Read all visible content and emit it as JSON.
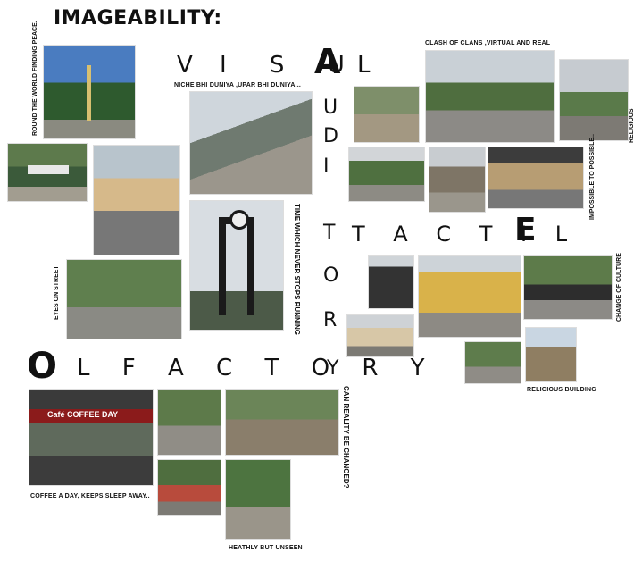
{
  "title": "IMAGEABILITY:",
  "senses": {
    "visual_v": "V",
    "visual_rest1": "I S U",
    "visual_a": "A",
    "visual_l": "L",
    "auditory_letters": [
      "U",
      "D",
      "I",
      "T",
      "O",
      "R",
      "Y"
    ],
    "tactile": "T A C T I L",
    "tactile_e": "E",
    "olfactory_o": "O",
    "olfactory_rest": "L F A C T O R Y"
  },
  "captions": {
    "round_world": "ROUND THE WORLD FINDING PEACE.",
    "niche_bhi": "NICHE BHI DUNIYA ,UPAR BHI DUNIYA...",
    "clash_of_clans": "CLASH OF CLANS ,VIRTUAL AND REAL",
    "religious": "RELIGIOUS",
    "impossible": "IMPOSSIBLE TO POSSIBLE..",
    "time_never": "TIME WHICH NEVER STOPS RUNNING",
    "eyes_on_street": "EYES ON STREET",
    "change_culture": "CHANGE OF CULTURE",
    "religious_building": "RELIGIOUS BUILDING",
    "can_reality": "CAN REALITY BE CHANGED?",
    "coffee_day": "COFFEE A DAY, KEEPS SLEEP AWAY..",
    "heathly": "HEATHLY BUT UNSEEN"
  },
  "signs": {
    "cafe": "Café COFFEE DAY"
  }
}
